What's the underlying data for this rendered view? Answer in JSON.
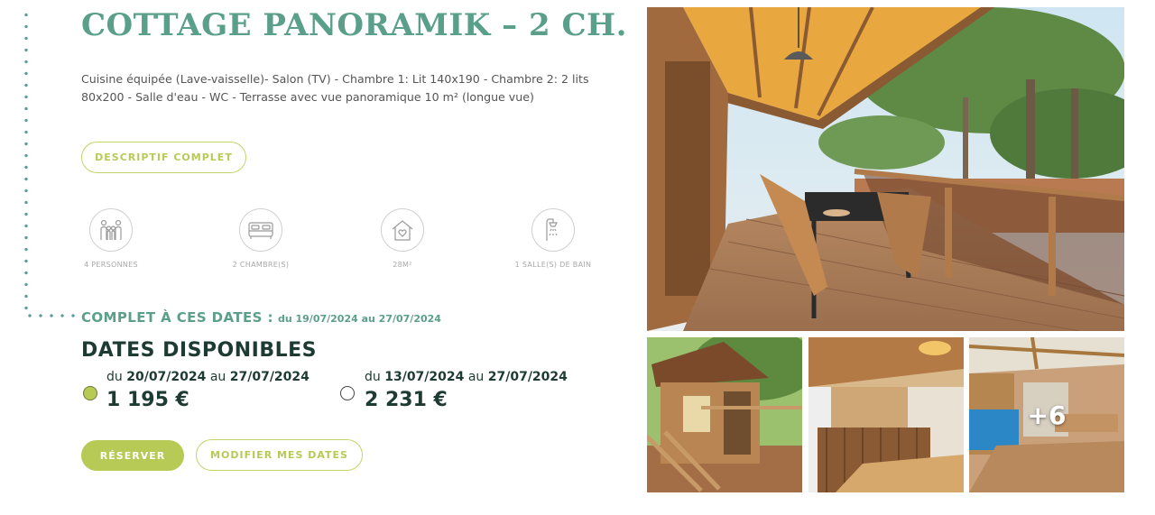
{
  "title": "COTTAGE PANORAMIK – 2 CH.",
  "description": "Cuisine équipée (Lave-vaisselle)- Salon (TV) - Chambre 1: Lit 140x190 - Chambre 2: 2 lits 80x200 - Salle d'eau - WC - Terrasse avec vue panoramique 10 m² (longue vue)",
  "buttons": {
    "descriptif": "DESCRIPTIF COMPLET",
    "reserver": "RÉSERVER",
    "modifier": "MODIFIER MES DATES"
  },
  "amenities": [
    {
      "label": "4 PERSONNES",
      "icon": "people-icon"
    },
    {
      "label": "2 CHAMBRE(S)",
      "icon": "bed-icon"
    },
    {
      "label": "28M²",
      "icon": "house-heart-icon"
    },
    {
      "label": "1 SALLE(S) DE BAIN",
      "icon": "shower-icon"
    }
  ],
  "complet": {
    "label": "COMPLET À CES DATES :",
    "dates": "du 19/07/2024 au 27/07/2024"
  },
  "dates_disponibles": {
    "heading": "DATES DISPONIBLES",
    "options": [
      {
        "du": "du",
        "from": "20/07/2024",
        "au": "au",
        "to": "27/07/2024",
        "price": "1 195 €",
        "selected": true
      },
      {
        "du": "du",
        "from": "13/07/2024",
        "au": "au",
        "to": "27/07/2024",
        "price": "2 231 €",
        "selected": false
      }
    ]
  },
  "gallery": {
    "more_count": "+6"
  },
  "colors": {
    "accent_green": "#b7ca55",
    "title_teal": "#5a9f8a",
    "dark_green": "#1d3b33"
  }
}
